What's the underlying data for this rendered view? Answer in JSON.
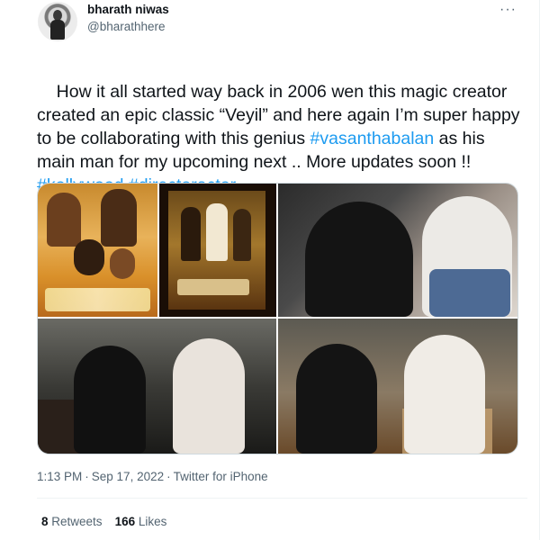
{
  "tweet": {
    "author_name": "bharath niwas",
    "author_handle": "@bharathhere",
    "more_icon": "more-horizontal-icon",
    "text_parts": [
      {
        "type": "text",
        "value": "How it all started way back in 2006 wen this magic creator created an epic classic “Veyil” and here again I’m super happy to be collaborating with this genius "
      },
      {
        "type": "link",
        "value": "#vasanthabalan"
      },
      {
        "type": "text",
        "value": " as his main man for my upcoming next .. More updates soon !! "
      },
      {
        "type": "link",
        "value": "#kollywood"
      },
      {
        "type": "text",
        "value": " "
      },
      {
        "type": "link",
        "value": "#directoractor"
      }
    ],
    "time": "1:13 PM",
    "date": "Sep 17, 2022",
    "source": "Twitter for iPhone",
    "retweets_count": "8",
    "retweets_label": "Retweets",
    "likes_count": "166",
    "likes_label": "Likes",
    "colors": {
      "link": "#1d9bf0",
      "secondary_text": "#536471",
      "primary_text": "#0f1419",
      "border": "#cfd9de"
    }
  }
}
